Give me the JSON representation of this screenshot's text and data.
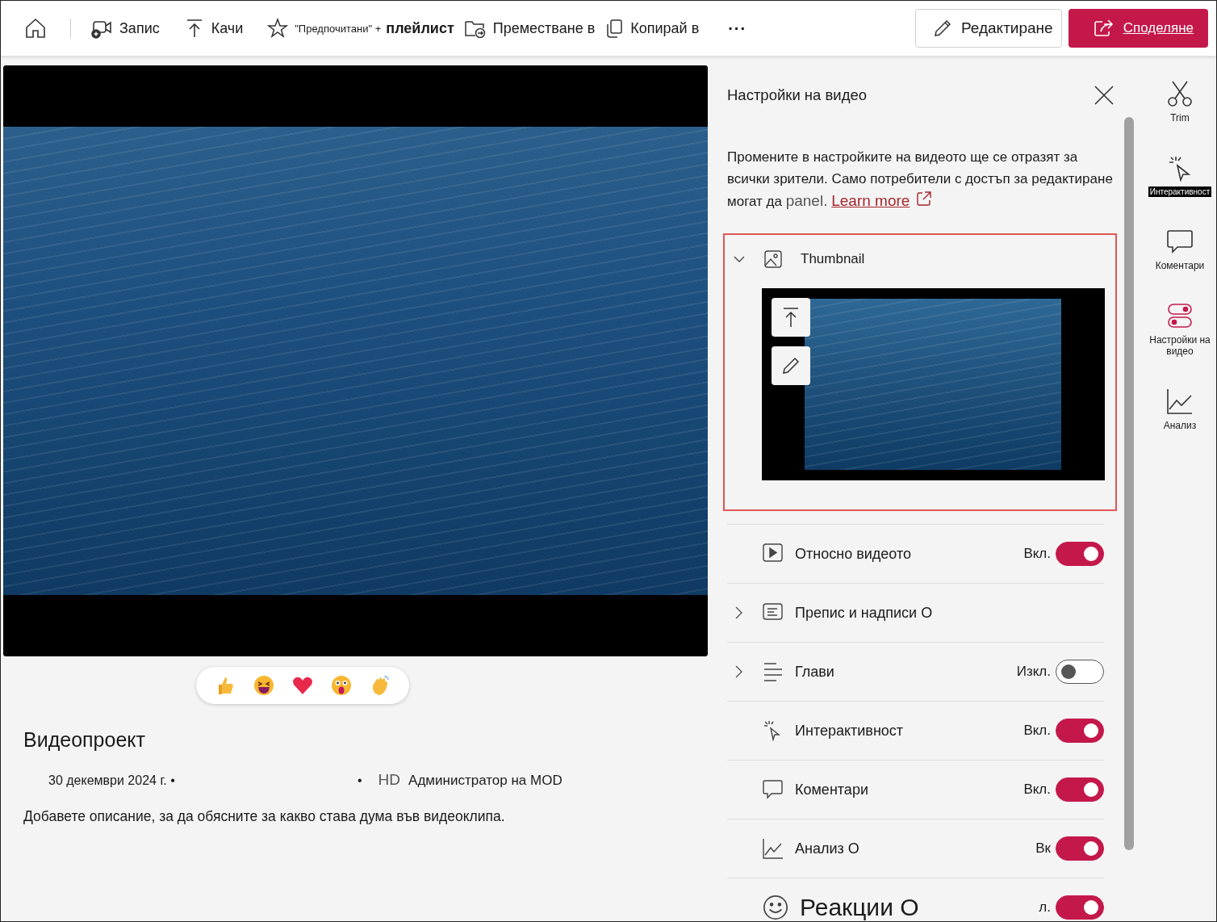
{
  "toolbar": {
    "items": [
      {
        "kind": "record",
        "label": "Запис"
      },
      {
        "kind": "upload",
        "label": "Качи"
      },
      {
        "kind": "favorite",
        "prefix": "\"Предпочитани\" +",
        "label": "плейлист"
      },
      {
        "kind": "move",
        "label": "Преместване в"
      },
      {
        "kind": "copy",
        "label": "Копирай в"
      }
    ],
    "more": "···",
    "edit_button": "Редактиране",
    "share_button": "Споделяне"
  },
  "video": {
    "reactions": [
      {
        "kind": "like"
      },
      {
        "kind": "laugh"
      },
      {
        "kind": "heart"
      },
      {
        "kind": "surprised"
      },
      {
        "kind": "applause"
      }
    ],
    "title": "Видеопроект",
    "date": "30 декември 2024 г. •",
    "separator": "•",
    "quality": "HD",
    "owner": "Администратор на MOD",
    "description": "Добавете описание, за да обясните за какво става дума във видеоклипа."
  },
  "panel": {
    "title": "Настройки на видео",
    "description": "Промените в настройките на видеото ще се отразят за всички зрители. Само потребители с достъп за редактиране могат да",
    "description_tail": "panel.",
    "link": "Learn more",
    "thumbnail": {
      "label": "Thumbnail",
      "expanded": true
    },
    "rows": [
      {
        "kind": "toggle",
        "label": "Относно видеото",
        "expandable": false,
        "large": false,
        "reading": "Вкл.",
        "on": true
      },
      {
        "kind": "plain",
        "label": "Препис и надписи O",
        "expandable": true,
        "large": false
      },
      {
        "kind": "toggle",
        "label": "Глави",
        "expandable": true,
        "large": false,
        "reading": "Изкл.",
        "on": false
      },
      {
        "kind": "toggle",
        "label": "Интерактивност",
        "expandable": false,
        "large": false,
        "reading": "Вкл.",
        "on": true
      },
      {
        "kind": "toggle",
        "label": "Коментари",
        "expandable": false,
        "large": false,
        "reading": "Вкл.",
        "on": true
      },
      {
        "kind": "toggle",
        "label": "Анализ O",
        "expandable": false,
        "large": false,
        "reading": "Вк",
        "on": true
      },
      {
        "kind": "toggle",
        "label": "Реакции O",
        "expandable": false,
        "large": true,
        "reading": "л.",
        "on": true
      }
    ]
  },
  "rail": [
    {
      "label": "Trim",
      "selected": false,
      "tooltip": false
    },
    {
      "label": "Интерактивност",
      "selected": false,
      "tooltip": true
    },
    {
      "label": "Коментари",
      "selected": false,
      "tooltip": false
    },
    {
      "label": "Настройки на видео",
      "selected": true,
      "tooltip": false
    },
    {
      "label": "Анализ",
      "selected": false,
      "tooltip": false
    }
  ]
}
